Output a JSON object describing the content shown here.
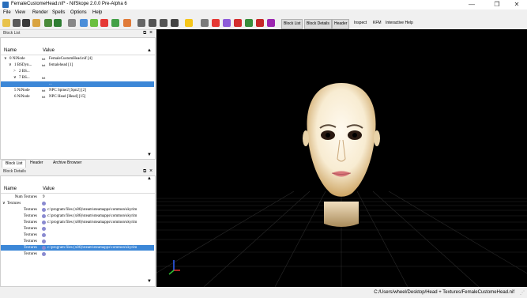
{
  "window": {
    "title": "FemaleCustomeHead.nif* - NifSkope 2.0.0 Pre-Alpha 6",
    "min": "—",
    "max": "❐",
    "close": "✕"
  },
  "menu": [
    "File",
    "View",
    "Render",
    "Spells",
    "Options",
    "Help"
  ],
  "toolbar_tabs": [
    "Block List",
    "Block Details",
    "Header",
    "Inspect",
    "KFM",
    "Interactive Help"
  ],
  "block_list": {
    "title": "Block List",
    "col_name": "Name",
    "col_value": "Value",
    "rows": [
      {
        "arrow": "∨",
        "name": "0 NiNode",
        "type": "txt",
        "value": "FemaleCustomHead.nif [4]",
        "indent": 0,
        "selected": false
      },
      {
        "arrow": "∨",
        "name": "1 BSDyn...",
        "type": "txt",
        "value": "femalehead [1]",
        "indent": 1,
        "selected": false
      },
      {
        "arrow": ">",
        "name": "2 BS...",
        "type": "",
        "value": "",
        "indent": 2,
        "selected": false
      },
      {
        "arrow": "∨",
        "name": "7 BS...",
        "type": "txt",
        "value": "",
        "indent": 2,
        "selected": false
      },
      {
        "arrow": "",
        "name": "",
        "type": "",
        "value": "...",
        "indent": 3,
        "selected": true
      },
      {
        "arrow": "",
        "name": "5 NiNode",
        "type": "txt",
        "value": "NPC Spine2 [Spn2] [2]",
        "indent": 1,
        "selected": false
      },
      {
        "arrow": "",
        "name": "6 NiNode",
        "type": "txt",
        "value": "NPC Head [Head] [15]",
        "indent": 1,
        "selected": false
      }
    ]
  },
  "tabs": [
    "Block List",
    "Header",
    "Archive Browser"
  ],
  "block_details": {
    "title": "Block Details",
    "col_name": "Name",
    "col_value": "Value",
    "rows": [
      {
        "name": "Num Textures",
        "value": "9",
        "icon": false,
        "selected": false
      },
      {
        "name": "Textures",
        "value": "",
        "icon": true,
        "selected": false
      },
      {
        "name": "Textures",
        "value": "c:\\program files (x86)\\steam\\steamapps\\common\\skyrim",
        "icon": true,
        "selected": false
      },
      {
        "name": "Textures",
        "value": "c:\\program files (x86)\\steam\\steamapps\\common\\skyrim",
        "icon": true,
        "selected": false
      },
      {
        "name": "Textures",
        "value": "c:\\program files (x86)\\steam\\steamapps\\common\\skyrim",
        "icon": true,
        "selected": false
      },
      {
        "name": "Textures",
        "value": "",
        "icon": true,
        "selected": false
      },
      {
        "name": "Textures",
        "value": "",
        "icon": true,
        "selected": false
      },
      {
        "name": "Textures",
        "value": "",
        "icon": true,
        "selected": false
      },
      {
        "name": "Textures",
        "value": "c:\\program files (x86)\\steam\\steamapps\\common\\skyrim",
        "icon": true,
        "selected": true
      },
      {
        "name": "Textures",
        "value": "",
        "icon": true,
        "selected": false
      }
    ]
  },
  "status": "C:/Users/wheel/Desktop/Head + Textures/FemaleCustomeHead.nif",
  "colors": {
    "selection": "#3c87d7",
    "viewport": "#000000",
    "grid": "#2a2a2a"
  }
}
